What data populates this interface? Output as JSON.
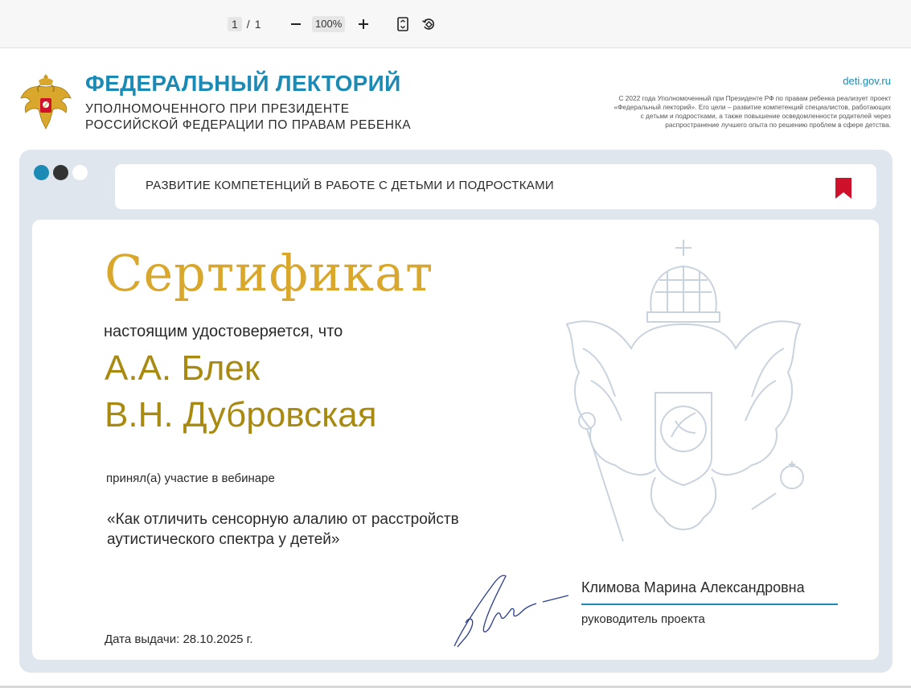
{
  "viewer": {
    "page_current": "1",
    "page_separator": "/",
    "page_total": "1",
    "zoom_label": "100%",
    "zoom_out_icon": "minus-icon",
    "zoom_in_icon": "plus-icon",
    "fit_page_icon": "fit-page-icon",
    "rotate_icon": "rotate-icon"
  },
  "header": {
    "title": "ФЕДЕРАЛЬНЫЙ ЛЕКТОРИЙ",
    "subtitle_line1": "УПОЛНОМОЧЕННОГО ПРИ ПРЕЗИДЕНТЕ",
    "subtitle_line2": "РОССИЙСКОЙ ФЕДЕРАЦИИ ПО ПРАВАМ РЕБЕНКА",
    "site": "deti.gov.ru",
    "blurb_lines": [
      "С 2022 года Уполномоченный при Президенте РФ по правам ребенка реализует проект",
      "«Федеральный лекторий». Его цели – развитие компетенций специалистов, работающих",
      "с детьми и подростками, а также повышение осведомленности родителей через",
      "распространение лучшего опыта по решению проблем в сфере детства."
    ]
  },
  "topic": "РАЗВИТИЕ КОМПЕТЕНЦИЙ В РАБОТЕ С ДЕТЬМИ И ПОДРОСТКАМИ",
  "certificate": {
    "title": "Сертификат",
    "certify_text": "настоящим удостоверяется, что",
    "names": [
      "А.А. Блек",
      "В.Н. Дубровская"
    ],
    "participated": "принял(а) участие в вебинаре",
    "webinar_line1": "«Как отличить сенсорную алалию от расстройств",
    "webinar_line2": "аутистического спектра у детей»",
    "issue_label": "Дата выдачи:",
    "issue_date": "28.10.2025 г.",
    "signer_name": "Климова Марина Александровна",
    "signer_role": "руководитель проекта"
  },
  "colors": {
    "accent_blue": "#1b8ab4",
    "gold_title": "#d8a72c",
    "gold_names": "#a88a10",
    "bookmark_red": "#d0112b",
    "panel_bg": "#dfe6ee",
    "dot_blue": "#1b8ab4",
    "dot_dark": "#333333",
    "dot_white": "#ffffff"
  }
}
